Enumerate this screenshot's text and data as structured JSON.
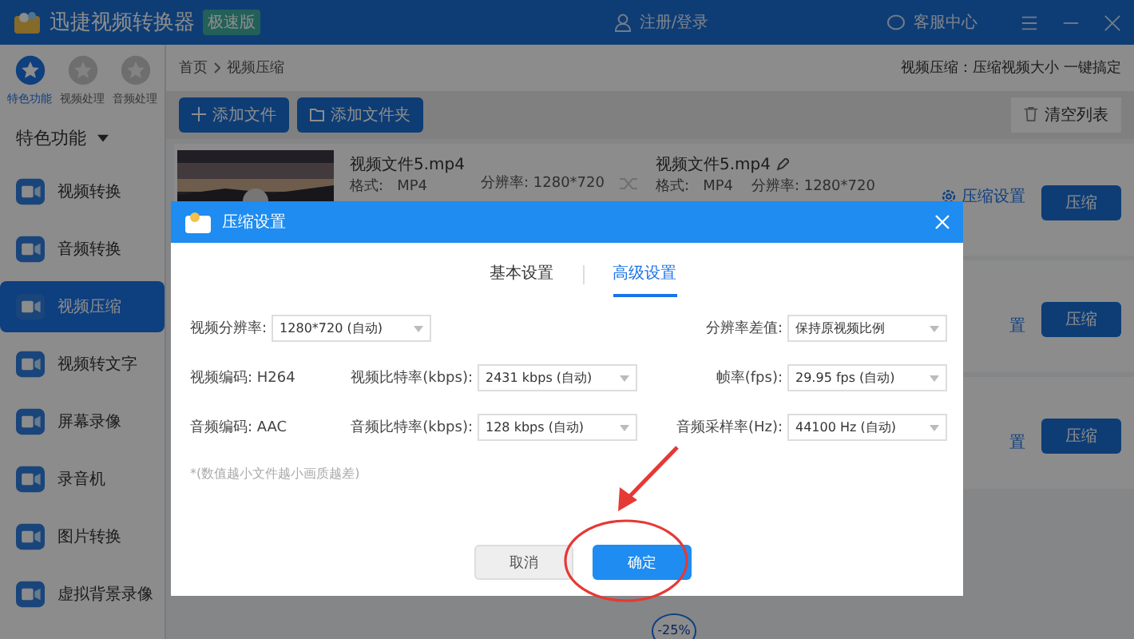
{
  "app": {
    "title": "迅捷视频转换器",
    "edition": "极速版",
    "login": "注册/登录",
    "support": "客服中心"
  },
  "sidebar": {
    "categories": [
      {
        "label": "特色功能",
        "selected": true
      },
      {
        "label": "视频处理",
        "selected": false
      },
      {
        "label": "音频处理",
        "selected": false
      }
    ],
    "section": "特色功能",
    "items": [
      {
        "label": "视频转换",
        "selected": false
      },
      {
        "label": "音频转换",
        "selected": false
      },
      {
        "label": "视频压缩",
        "selected": true
      },
      {
        "label": "视频转文字",
        "selected": false
      },
      {
        "label": "屏幕录像",
        "selected": false
      },
      {
        "label": "录音机",
        "selected": false
      },
      {
        "label": "图片转换",
        "selected": false
      },
      {
        "label": "虚拟背景录像",
        "selected": false
      }
    ]
  },
  "breadcrumb": [
    "首页",
    "视频压缩"
  ],
  "tagline": "视频压缩：压缩视频大小 一键搞定",
  "toolbar": {
    "add_file": "添加文件",
    "add_folder": "添加文件夹",
    "clear": "清空列表"
  },
  "files": [
    {
      "kind": "full",
      "name": "视频文件5.mp4",
      "format_label": "格式:",
      "format": "MP4",
      "res_label": "分辨率:",
      "resolution": "1280*720",
      "out_name": "视频文件5.mp4",
      "out_format_label": "格式:",
      "out_format": "MP4",
      "out_res_label": "分辨率:",
      "out_resolution": "1280*720",
      "settings": "压缩设置",
      "action": "压缩"
    },
    {
      "kind": "covered",
      "settings": "置",
      "action": "压缩"
    },
    {
      "kind": "covered",
      "settings": "置",
      "action": "压缩"
    }
  ],
  "ratio_badge": "-25%",
  "dialog": {
    "title": "压缩设置",
    "tabs": [
      {
        "label": "基本设置",
        "selected": false
      },
      {
        "label": "高级设置",
        "selected": true
      }
    ],
    "rows": [
      [
        {
          "kind": "select",
          "label": "视频分辨率:",
          "value": "1280*720 (自动)"
        },
        {
          "kind": "empty"
        },
        {
          "kind": "select",
          "label": "分辨率差值:",
          "value": "保持原视频比例"
        }
      ],
      [
        {
          "kind": "text",
          "label": "视频编码:",
          "value": "H264"
        },
        {
          "kind": "select",
          "label": "视频比特率(kbps):",
          "value": "2431 kbps (自动)"
        },
        {
          "kind": "select",
          "label": "帧率(fps):",
          "value": "29.95 fps (自动)"
        }
      ],
      [
        {
          "kind": "text",
          "label": "音频编码:",
          "value": "AAC"
        },
        {
          "kind": "select",
          "label": "音频比特率(kbps):",
          "value": "128 kbps (自动)"
        },
        {
          "kind": "select",
          "label": "音频采样率(Hz):",
          "value": "44100 Hz (自动)"
        }
      ]
    ],
    "note": "*(数值越小文件越小画质越差)",
    "cancel": "取消",
    "confirm": "确定"
  }
}
